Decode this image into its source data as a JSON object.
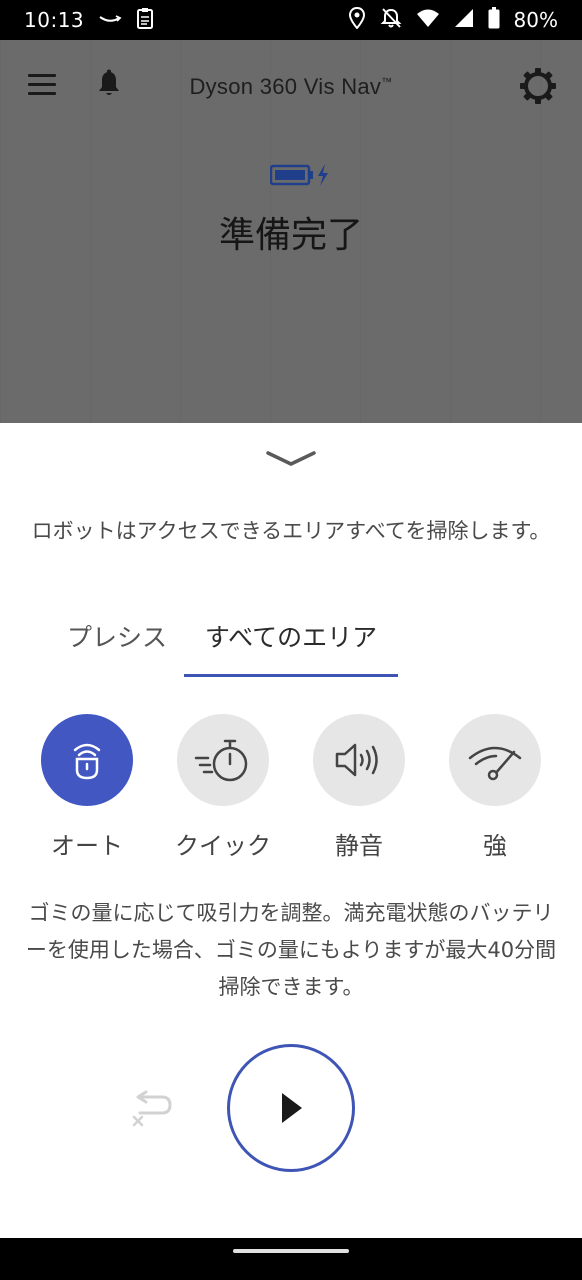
{
  "status_bar": {
    "time": "10:13",
    "battery_percent": "80%",
    "icons": [
      "amazon-smile-icon",
      "clipboard-icon",
      "location-icon",
      "notifications-off-icon",
      "wifi-icon",
      "cellular-signal-icon",
      "battery-icon"
    ]
  },
  "app_bar": {
    "title": "Dyson 360 Vis Nav",
    "title_mark": "™",
    "icons": [
      "menu-icon",
      "bell-icon",
      "gear-icon"
    ]
  },
  "robot_status": {
    "battery_icon": "battery-charging-icon",
    "status_text": "準備完了"
  },
  "sheet": {
    "collapse_icon": "chevron-down-icon",
    "area_description": "ロボットはアクセスできるエリアすべてを掃除します。",
    "tabs": [
      {
        "label": "プレシス",
        "selected": false
      },
      {
        "label": "すべてのエリア",
        "selected": true
      }
    ],
    "modes": [
      {
        "label": "オート",
        "icon": "auto-mode-icon",
        "selected": true
      },
      {
        "label": "クイック",
        "icon": "quick-timer-icon",
        "selected": false
      },
      {
        "label": "静音",
        "icon": "speaker-icon",
        "selected": false
      },
      {
        "label": "強",
        "icon": "gauge-icon",
        "selected": false
      }
    ],
    "mode_description": "ゴミの量に応じて吸引力を調整。満充電状態のバッテリーを使用した場合、ゴミの量にもよりますが最大40分間掃除できます。",
    "actions": {
      "dock_icon": "return-to-dock-icon",
      "play_icon": "play-icon"
    }
  },
  "colors": {
    "accent": "#4257c2",
    "overlay": "#6b6b6b",
    "inactive_mode": "#e6e6e6"
  }
}
